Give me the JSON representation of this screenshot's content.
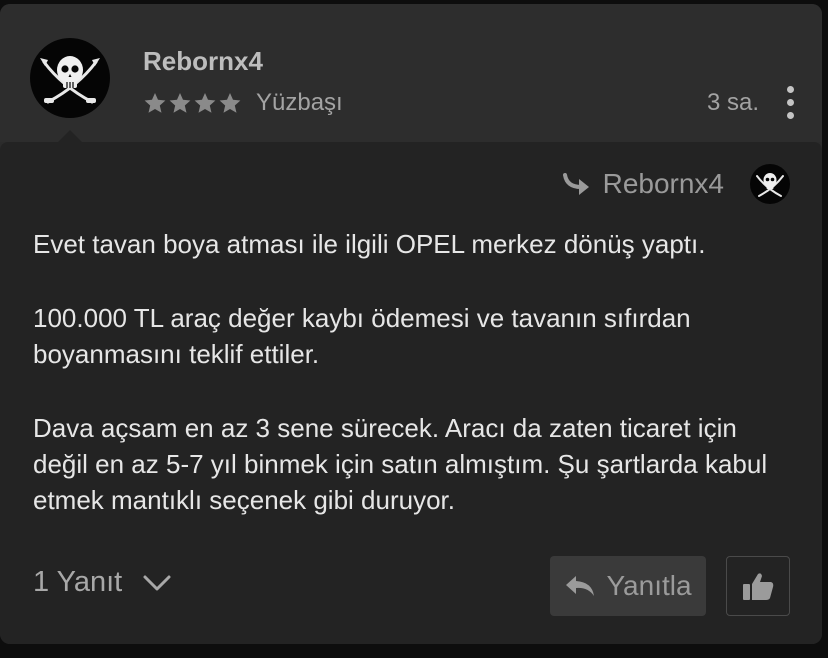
{
  "comment": {
    "author": "Rebornx4",
    "rank": "Yüzbaşı",
    "stars": 4,
    "time": "3 sa.",
    "reply_to": "Rebornx4",
    "paragraphs": [
      "Evet tavan boya atması ile ilgili OPEL merkez dönüş yaptı.",
      "100.000 TL araç değer kaybı ödemesi ve tavanın sıfırdan boyanmasını teklif ettiler.",
      "Dava açsam en az 3 sene sürecek. Aracı da zaten ticaret için değil en az 5-7 yıl binmek için satın almıştım. Şu şartlarda kabul etmek mantıklı seçenek gibi duruyor."
    ]
  },
  "footer": {
    "replies_label": "1 Yanıt",
    "reply_button_label": "Yanıtla"
  },
  "icons": {
    "avatar": "pirate-skull-crossed-swords",
    "star": "star-icon",
    "menu": "vertical-ellipsis-icon",
    "reply_to": "curved-arrow-icon",
    "chevron": "chevron-down-icon",
    "reply": "reply-arrow-icon",
    "like": "thumbs-up-icon"
  },
  "colors": {
    "card_header": "#2d2d2d",
    "card_body": "#232323",
    "button_bg": "#3a3a3a",
    "text": "#e6e6e6",
    "muted": "#a3a3a3"
  }
}
